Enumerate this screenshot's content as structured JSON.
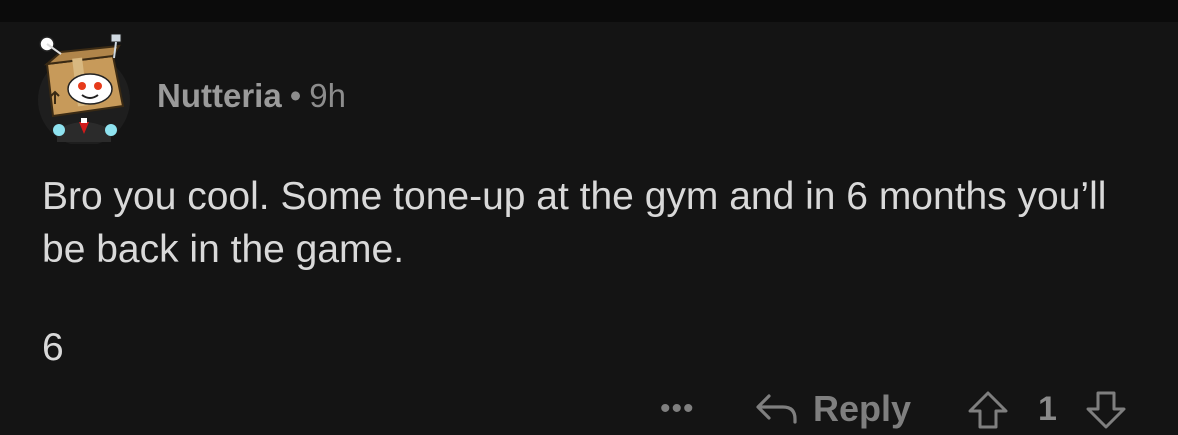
{
  "comment": {
    "username": "Nutteria",
    "separator": "•",
    "time_ago": "9h",
    "body": "Bro you cool. Some tone-up at the gym and in 6 months you’ll be back in the game.",
    "extra_line": "6"
  },
  "actions": {
    "more": "•••",
    "reply_label": "Reply",
    "vote_count": "1"
  },
  "colors": {
    "background": "#141414",
    "top_bar": "#0b0b0b",
    "meta_text": "#8d8d8d",
    "body_text": "#d9d9d9",
    "action_icons": "#7f7f7f"
  },
  "icons": {
    "avatar": "snoo-cardboard-box-avatar",
    "reply": "reply-arrow-icon",
    "upvote": "upvote-arrow-icon",
    "downvote": "downvote-arrow-icon"
  }
}
